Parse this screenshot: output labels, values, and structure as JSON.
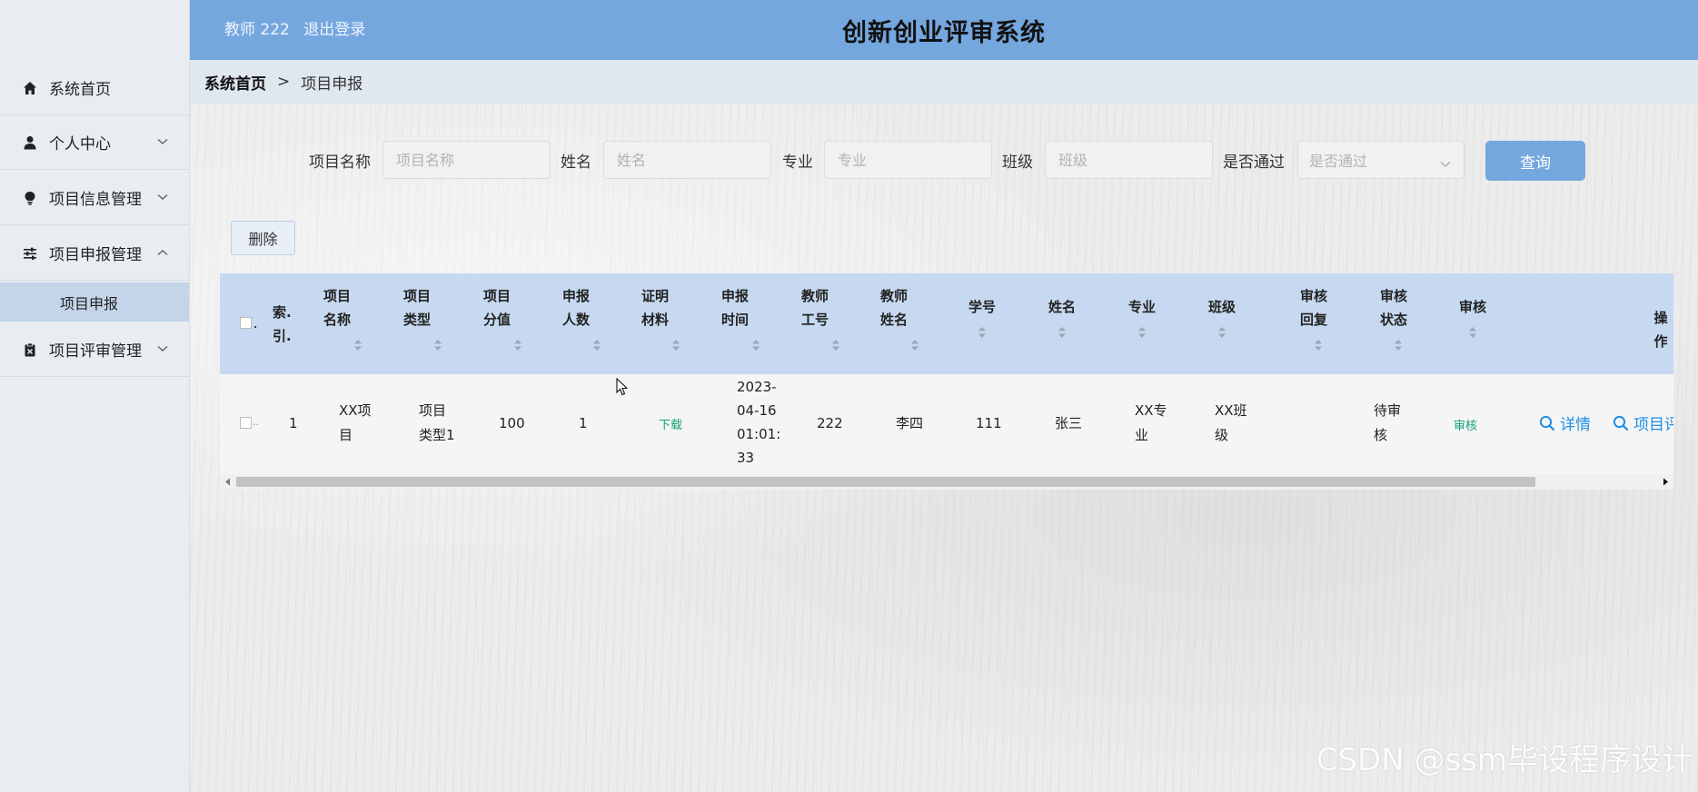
{
  "header": {
    "user_label": "教师 222",
    "logout": "退出登录",
    "title": "创新创业评审系统"
  },
  "sidebar": {
    "items": [
      {
        "label": "系统首页",
        "icon": "home-icon"
      },
      {
        "label": "个人中心",
        "icon": "user-icon"
      },
      {
        "label": "项目信息管理",
        "icon": "bulb-icon"
      },
      {
        "label": "项目申报管理",
        "icon": "sliders-icon"
      },
      {
        "label": "项目评审管理",
        "icon": "clipboard-icon"
      }
    ],
    "sub_item": "项目申报"
  },
  "breadcrumb": {
    "home": "系统首页",
    "separator": ">",
    "current": "项目申报"
  },
  "search": {
    "name_label": "项目名称",
    "name_placeholder": "项目名称",
    "xingming_label": "姓名",
    "xingming_placeholder": "姓名",
    "major_label": "专业",
    "major_placeholder": "专业",
    "class_label": "班级",
    "class_placeholder": "班级",
    "pass_label": "是否通过",
    "pass_placeholder": "是否通过",
    "query_button": "查询"
  },
  "toolbar": {
    "delete_button": "删除"
  },
  "table": {
    "headers": {
      "index": [
        "索.",
        "引."
      ],
      "name": [
        "项目",
        "名称"
      ],
      "type": [
        "项目",
        "类型"
      ],
      "score": [
        "项目",
        "分值"
      ],
      "count": [
        "申报",
        "人数"
      ],
      "material": [
        "证明",
        "材料"
      ],
      "time": [
        "申报",
        "时间"
      ],
      "tno": [
        "教师",
        "工号"
      ],
      "tname": [
        "教师",
        "姓名"
      ],
      "sno": "学号",
      "sname": "姓名",
      "major": "专业",
      "class": "班级",
      "reply": [
        "审核",
        "回复"
      ],
      "status": [
        "审核",
        "状态"
      ],
      "audit": "审核",
      "ops": "操作"
    },
    "row": {
      "index": "1",
      "name": [
        "XX项",
        "目"
      ],
      "type": [
        "项目",
        "类型1"
      ],
      "score": "100",
      "count": "1",
      "material": "下载",
      "time": [
        "2023-",
        "04-16",
        "01:01:",
        "33"
      ],
      "tno": "222",
      "tname": "李四",
      "sno": "111",
      "sname": "张三",
      "major": [
        "XX专",
        "业"
      ],
      "class": [
        "XX班",
        "级"
      ],
      "reply": "",
      "status": [
        "待审",
        "核"
      ],
      "audit": "审核",
      "detail": "详情",
      "review": "项目评"
    }
  },
  "watermark": "CSDN @ssm毕设程序设计",
  "colors": {
    "header_bg": "#75a7df",
    "sidebar_bg": "#e9edf1",
    "table_head_bg": "#c6d9f0",
    "link": "#1f8fe5",
    "green_link": "#12a07a"
  }
}
